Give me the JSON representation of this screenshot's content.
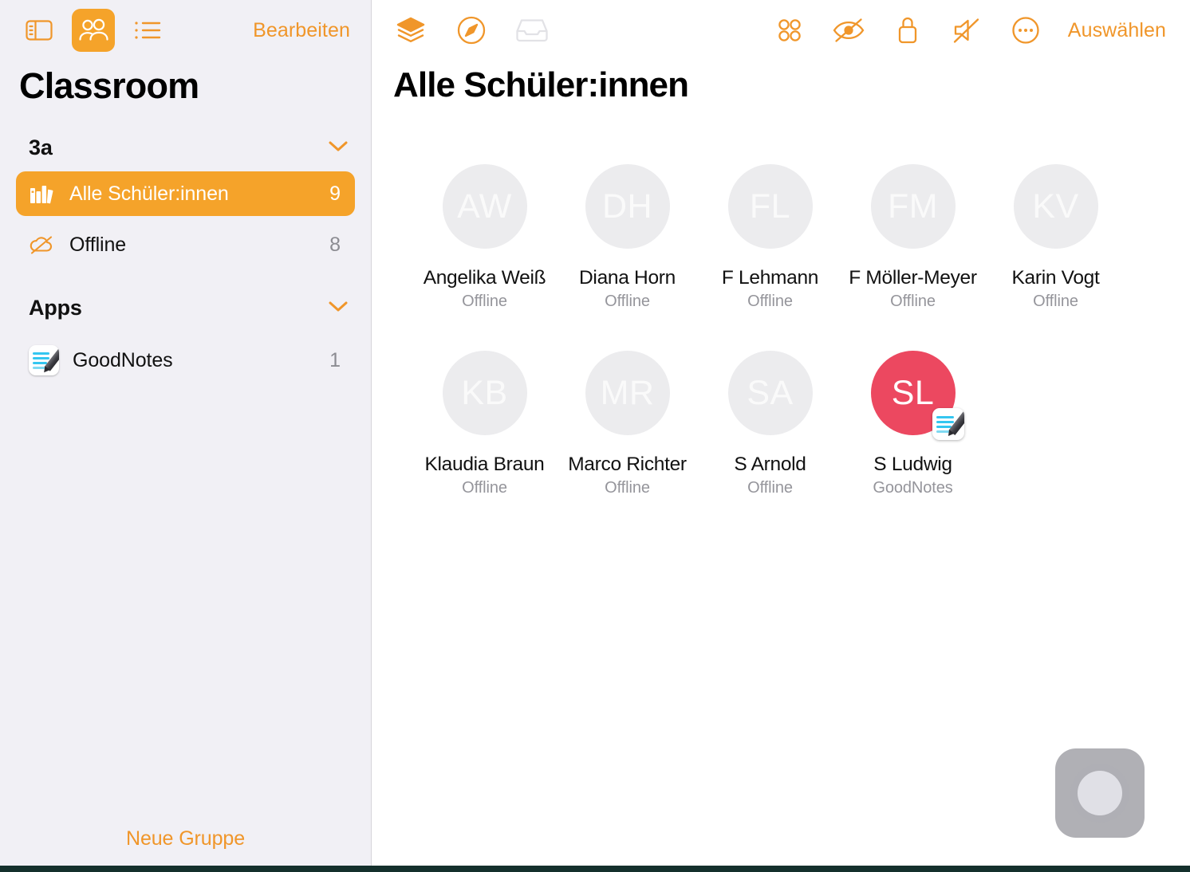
{
  "theme": {
    "accent": "#f0962a",
    "accent_selected_bg": "#f5a32a",
    "sidebar_bg": "#f1f0f5",
    "avatar_bg": "#ececee",
    "active_avatar_bg": "#ec4860",
    "status_text": "#95959b"
  },
  "sidebar": {
    "toolbar": {
      "sidebar_toggle_icon": "sidebar-toggle-icon",
      "people_icon": "people-group-icon",
      "list_icon": "bulleted-list-icon",
      "edit_label": "Bearbeiten"
    },
    "title": "Classroom",
    "sections": [
      {
        "label": "3a",
        "chevron_icon": "chevron-down-icon",
        "rows": [
          {
            "icon": "books-icon",
            "label": "Alle Schüler:innen",
            "count": "9",
            "selected": true
          },
          {
            "icon": "cloud-slash-icon",
            "label": "Offline",
            "count": "8",
            "selected": false
          }
        ]
      },
      {
        "label": "Apps",
        "chevron_icon": "chevron-down-icon",
        "rows": [
          {
            "icon": "goodnotes-app-icon",
            "label": "GoodNotes",
            "count": "1",
            "selected": false
          }
        ]
      }
    ],
    "footer": {
      "new_group_label": "Neue Gruppe"
    }
  },
  "main": {
    "toolbar": {
      "left_icons": [
        {
          "name": "layers-icon",
          "enabled": true
        },
        {
          "name": "compass-navigate-icon",
          "enabled": true
        },
        {
          "name": "inbox-tray-icon",
          "enabled": false
        }
      ],
      "right_icons": [
        {
          "name": "apps-grid-icon",
          "enabled": true
        },
        {
          "name": "eye-slash-icon",
          "enabled": true
        },
        {
          "name": "lock-icon",
          "enabled": true
        },
        {
          "name": "speaker-mute-icon",
          "enabled": true
        },
        {
          "name": "more-ellipsis-icon",
          "enabled": true
        }
      ],
      "select_label": "Auswählen"
    },
    "title": "Alle Schüler:innen",
    "students": [
      {
        "initials": "AW",
        "name": "Angelika Weiß",
        "status": "Offline",
        "active": false,
        "badge": null
      },
      {
        "initials": "DH",
        "name": "Diana Horn",
        "status": "Offline",
        "active": false,
        "badge": null
      },
      {
        "initials": "FL",
        "name": "F Lehmann",
        "status": "Offline",
        "active": false,
        "badge": null
      },
      {
        "initials": "FM",
        "name": "F Möller-Meyer",
        "status": "Offline",
        "active": false,
        "badge": null
      },
      {
        "initials": "KV",
        "name": "Karin Vogt",
        "status": "Offline",
        "active": false,
        "badge": null
      },
      {
        "initials": "KB",
        "name": "Klaudia Braun",
        "status": "Offline",
        "active": false,
        "badge": null
      },
      {
        "initials": "MR",
        "name": "Marco Richter",
        "status": "Offline",
        "active": false,
        "badge": null
      },
      {
        "initials": "SA",
        "name": "S Arnold",
        "status": "Offline",
        "active": false,
        "badge": null
      },
      {
        "initials": "SL",
        "name": "S Ludwig",
        "status": "GoodNotes",
        "active": true,
        "badge": "goodnotes-app-icon"
      }
    ]
  },
  "overlay": {
    "assistive_touch": "assistive-touch-button"
  }
}
